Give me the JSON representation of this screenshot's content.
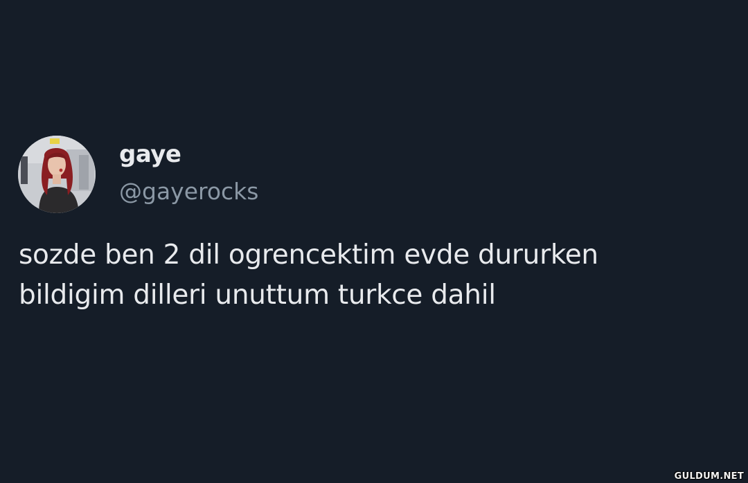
{
  "tweet": {
    "display_name": "gaye",
    "handle": "@gayerocks",
    "text_line1": "sozde ben 2 dil ogrencektim evde dururken",
    "text_line2": "bildigim dilleri unuttum turkce dahil"
  },
  "avatar": {
    "icon": "profile-photo",
    "colors": {
      "background": "#c9ccd1",
      "hair": "#8a1e22",
      "skin": "#e8c3ad",
      "jacket": "#2b2a2c"
    }
  },
  "watermark": {
    "text": "GULDUM.NET"
  },
  "theme": {
    "background": "#151d28",
    "primary_text": "#e8eaed",
    "secondary_text": "#8b98a5"
  }
}
